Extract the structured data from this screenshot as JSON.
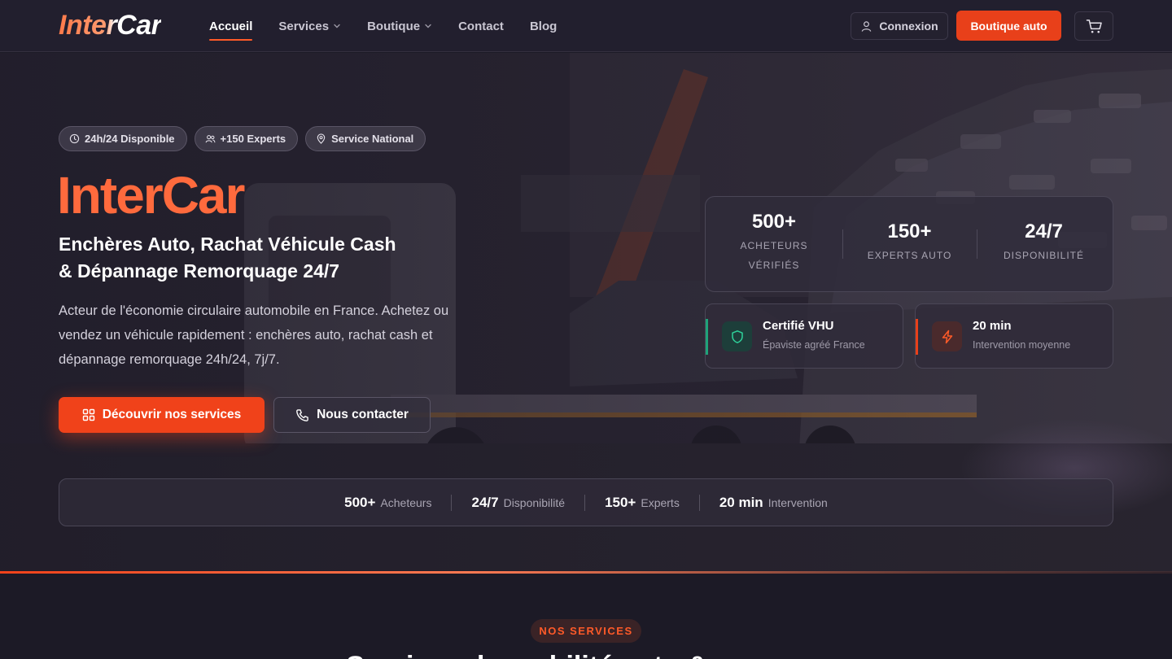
{
  "brand": {
    "logo_text": "InterCar"
  },
  "nav": {
    "links": [
      {
        "label": "Accueil",
        "active": true
      },
      {
        "label": "Services",
        "dropdown": true
      },
      {
        "label": "Boutique",
        "dropdown": true
      },
      {
        "label": "Contact"
      },
      {
        "label": "Blog"
      }
    ],
    "login_label": "Connexion",
    "shop_label": "Boutique auto",
    "cart_icon": "cart-icon"
  },
  "hero": {
    "badges": [
      {
        "icon": "clock-icon",
        "label": "24h/24 Disponible"
      },
      {
        "icon": "users-icon",
        "label": "+150 Experts"
      },
      {
        "icon": "map-pin-icon",
        "label": "Service National"
      }
    ],
    "title": "InterCar",
    "subtitle_line1": "Enchères Auto, Rachat Véhicule Cash",
    "subtitle_line2": "& Dépannage Remorquage 24/7",
    "description": "Acteur de l'économie circulaire automobile en France. Achetez ou vendez un véhicule rapidement : enchères auto, rachat cash et dépannage remorquage 24h/24, 7j/7.",
    "cta_primary": "Découvrir nos services",
    "cta_secondary": "Nous contacter",
    "stats": [
      {
        "value": "500+",
        "label_line1": "ACHETEURS",
        "label_line2": "VÉRIFIÉS"
      },
      {
        "value": "150+",
        "label_line1": "EXPERTS AUTO"
      },
      {
        "value": "24/7",
        "label_line1": "DISPONIBILITÉ"
      }
    ],
    "cards": [
      {
        "title": "Certifié VHU",
        "subtitle": "Épaviste agréé France",
        "icon": "shield-icon",
        "accent": "#1fa37a"
      },
      {
        "title": "20 min",
        "subtitle": "Intervention moyenne",
        "icon": "lightning-icon",
        "accent": "#e8401a"
      }
    ],
    "bar": [
      {
        "value": "500+",
        "label": "Acheteurs"
      },
      {
        "value": "24/7",
        "label": "Disponibilité"
      },
      {
        "value": "150+",
        "label": "Experts"
      },
      {
        "value": "20 min",
        "label": "Intervention"
      }
    ]
  },
  "services_section": {
    "pill": "NOS SERVICES",
    "heading": "Services de mobilité auto & annexes"
  },
  "colors": {
    "accent": "#f0421a",
    "brand_orange": "#ff6a3d",
    "green": "#1fa37a"
  }
}
